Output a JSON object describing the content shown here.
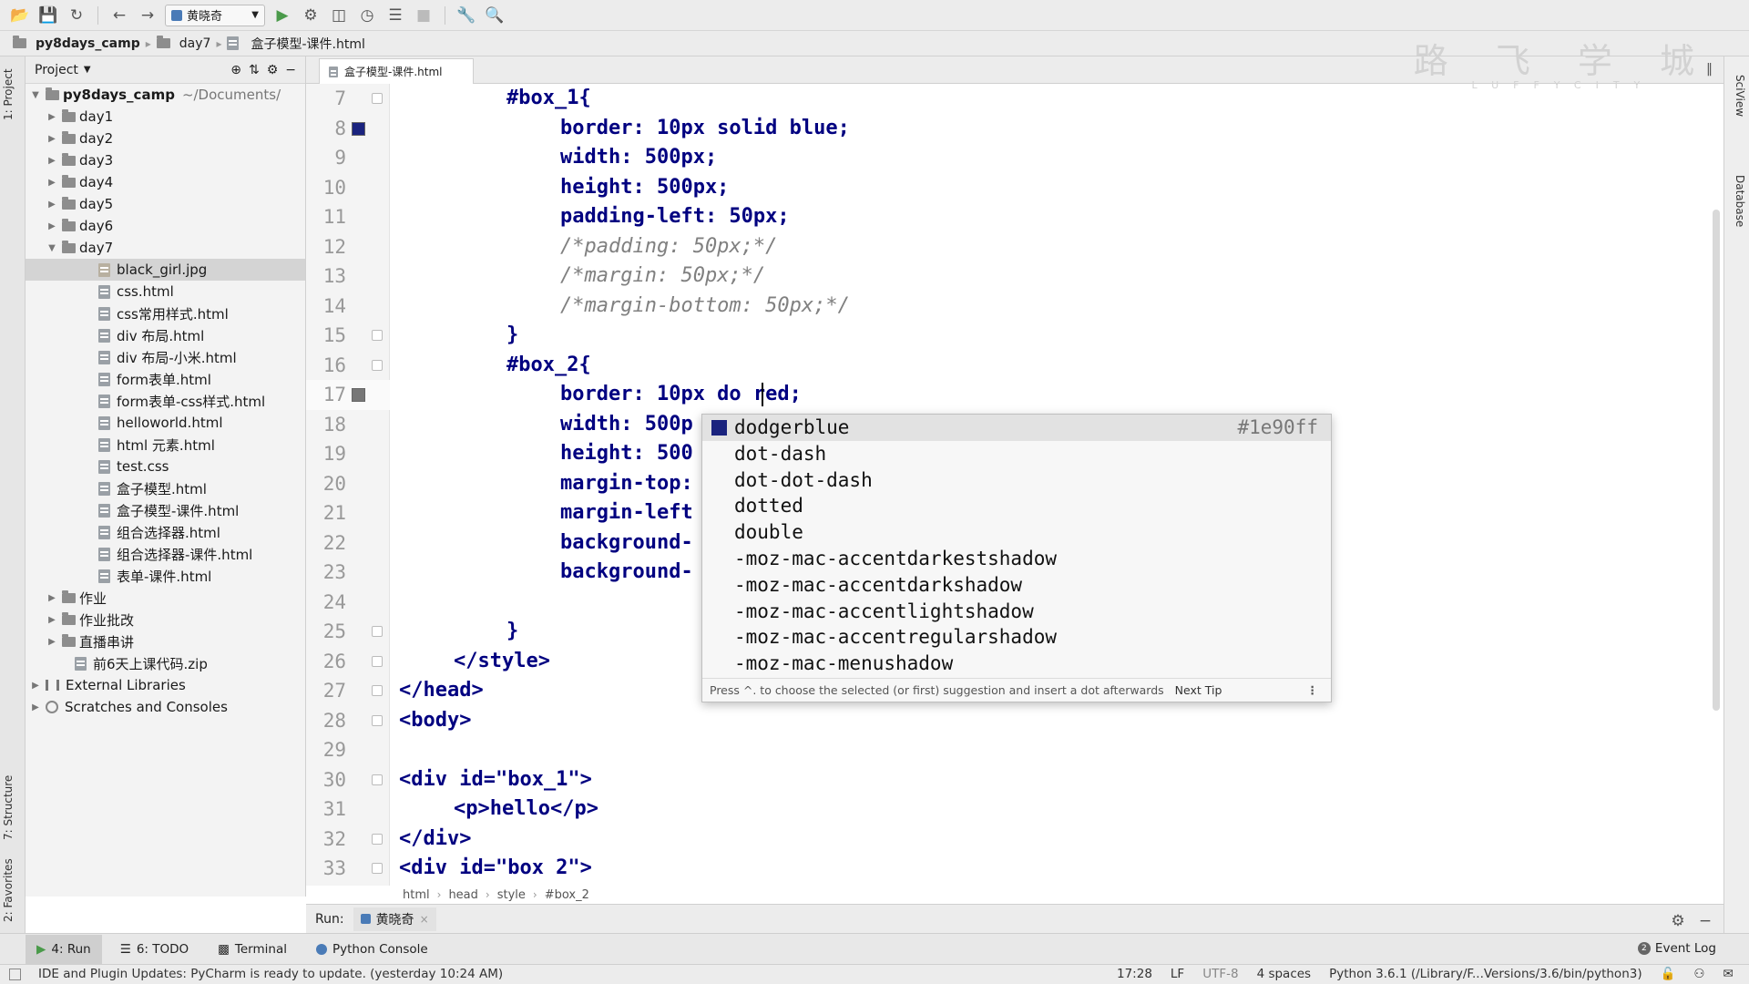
{
  "toolbar": {
    "run_config": "黄晓奇"
  },
  "navbar": {
    "crumbs": [
      "py8days_camp",
      "day7",
      "盒子模型-课件.html"
    ]
  },
  "watermark": {
    "chars": "路 飞 学 城",
    "sub": "LUFFYCITY"
  },
  "left_strip": {
    "project": "1: Project",
    "structure": "7: Structure",
    "favorites": "2: Favorites"
  },
  "right_strip": {
    "sciview": "SciView",
    "database": "Database"
  },
  "project_panel": {
    "title": "Project"
  },
  "tree": {
    "root": {
      "name": "py8days_camp",
      "path": "~/Documents/"
    },
    "items": [
      {
        "label": "day1"
      },
      {
        "label": "day2"
      },
      {
        "label": "day3"
      },
      {
        "label": "day4"
      },
      {
        "label": "day5"
      },
      {
        "label": "day6"
      },
      {
        "label": "day7"
      },
      {
        "label": "black_girl.jpg"
      },
      {
        "label": "css.html"
      },
      {
        "label": "css常用样式.html"
      },
      {
        "label": "div 布局.html"
      },
      {
        "label": "div 布局-小米.html"
      },
      {
        "label": "form表单.html"
      },
      {
        "label": "form表单-css样式.html"
      },
      {
        "label": "helloworld.html"
      },
      {
        "label": "html 元素.html"
      },
      {
        "label": "test.css"
      },
      {
        "label": "盒子模型.html"
      },
      {
        "label": "盒子模型-课件.html"
      },
      {
        "label": "组合选择器.html"
      },
      {
        "label": "组合选择器-课件.html"
      },
      {
        "label": "表单-课件.html"
      },
      {
        "label": "作业"
      },
      {
        "label": "作业批改"
      },
      {
        "label": "直播串讲"
      },
      {
        "label": "前6天上课代码.zip"
      },
      {
        "label": "External Libraries"
      },
      {
        "label": "Scratches and Consoles"
      }
    ]
  },
  "editor": {
    "tab": "盒子模型-课件.html",
    "lines": [
      {
        "n": "7",
        "t": "#box_1{"
      },
      {
        "n": "8",
        "t": "border: 10px solid blue;"
      },
      {
        "n": "9",
        "t": "width: 500px;"
      },
      {
        "n": "10",
        "t": "height: 500px;"
      },
      {
        "n": "11",
        "t": "padding-left: 50px;"
      },
      {
        "n": "12",
        "t": "/*padding: 50px;*/"
      },
      {
        "n": "13",
        "t": "/*margin: 50px;*/"
      },
      {
        "n": "14",
        "t": "/*margin-bottom: 50px;*/"
      },
      {
        "n": "15",
        "t": "}"
      },
      {
        "n": "16",
        "t": "#box_2{"
      },
      {
        "n": "17",
        "t": "border: 10px do red;"
      },
      {
        "n": "18",
        "t": "width: 500p"
      },
      {
        "n": "19",
        "t": "height: 500"
      },
      {
        "n": "20",
        "t": "margin-top:"
      },
      {
        "n": "21",
        "t": "margin-left"
      },
      {
        "n": "22",
        "t": "background-"
      },
      {
        "n": "23",
        "t": "background-"
      },
      {
        "n": "24",
        "t": ""
      },
      {
        "n": "25",
        "t": "}"
      },
      {
        "n": "26",
        "t": "</style>"
      },
      {
        "n": "27",
        "t": "</head>"
      },
      {
        "n": "28",
        "t": "<body>"
      },
      {
        "n": "29",
        "t": ""
      },
      {
        "n": "30",
        "t": "<div id=\"box_1\">"
      },
      {
        "n": "31",
        "t": "<p>hello</p>"
      },
      {
        "n": "32",
        "t": "</div>"
      },
      {
        "n": "33",
        "t": "<div id=\"box 2\">"
      }
    ],
    "breadcrumb": [
      "html",
      "head",
      "style",
      "#box_2"
    ]
  },
  "colors": {
    "blue": "#1a237e",
    "gray_swatch": "#777777",
    "dodgerblue": "#1e90ff"
  },
  "completion": {
    "items": [
      {
        "label": "dodgerblue",
        "hint": "#1e90ff"
      },
      {
        "label": "dot-dash"
      },
      {
        "label": "dot-dot-dash"
      },
      {
        "label": "dotted"
      },
      {
        "label": "double"
      },
      {
        "label": "-moz-mac-accentdarkestshadow"
      },
      {
        "label": "-moz-mac-accentdarkshadow"
      },
      {
        "label": "-moz-mac-accentlightshadow"
      },
      {
        "label": "-moz-mac-accentregularshadow"
      },
      {
        "label": "-moz-mac-menushadow"
      }
    ],
    "footer": "Press ^. to choose the selected (or first) suggestion and insert a dot afterwards",
    "next_tip": "Next Tip"
  },
  "run_panel": {
    "label": "Run:",
    "tab": "黄晓奇"
  },
  "tool_tabs": [
    {
      "label": "4: Run"
    },
    {
      "label": "6: TODO"
    },
    {
      "label": "Terminal"
    },
    {
      "label": "Python Console"
    }
  ],
  "event_log": "Event Log",
  "status": {
    "message": "IDE and Plugin Updates: PyCharm is ready to update. (yesterday 10:24 AM)",
    "position": "17:28",
    "line_sep": "LF",
    "encoding": "UTF-8",
    "indent": "4 spaces",
    "interpreter": "Python 3.6.1 (/Library/F...Versions/3.6/bin/python3)"
  }
}
